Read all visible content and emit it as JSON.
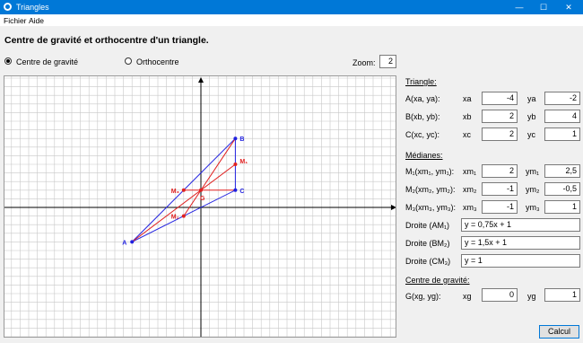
{
  "window": {
    "title": "Triangles",
    "minimize_glyph": "—",
    "maximize_glyph": "☐",
    "close_glyph": "✕"
  },
  "menu": {
    "file": "Fichier",
    "help": "Aide"
  },
  "heading": "Centre de gravité et orthocentre d'un triangle.",
  "options": {
    "gravity": "Centre de gravité",
    "orthocenter": "Orthocentre",
    "selected": "gravity"
  },
  "zoom": {
    "label": "Zoom:",
    "value": "2"
  },
  "plot": {
    "points": {
      "A": "A",
      "B": "B",
      "C": "C",
      "M1": "M₁",
      "M2": "M₂",
      "M3": "M₃",
      "G": "G"
    },
    "colors": {
      "triangle": "#2020e0",
      "median": "#e02020",
      "axis": "#000000",
      "grid": "#c8c8c8"
    }
  },
  "triangle": {
    "title": "Triangle:",
    "rows": [
      {
        "label": "A(xa, ya):",
        "xl": "xa",
        "xv": "-4",
        "yl": "ya",
        "yv": "-2"
      },
      {
        "label": "B(xb, yb):",
        "xl": "xb",
        "xv": "2",
        "yl": "yb",
        "yv": "4"
      },
      {
        "label": "C(xc, yc):",
        "xl": "xc",
        "xv": "2",
        "yl": "yc",
        "yv": "1"
      }
    ]
  },
  "medians": {
    "title": "Médianes:",
    "rows": [
      {
        "label": "M₁(xm₁, ym₁):",
        "xl": "xm₁",
        "xv": "2",
        "yl": "ym₁",
        "yv": "2,5"
      },
      {
        "label": "M₂(xm₂, ym₂):",
        "xl": "xm₂",
        "xv": "-1",
        "yl": "ym₂",
        "yv": "-0,5"
      },
      {
        "label": "M₃(xm₃, ym₃):",
        "xl": "xm₃",
        "xv": "-1",
        "yl": "ym₃",
        "yv": "1"
      }
    ],
    "lines": [
      {
        "label": "Droite (AM₁)",
        "eq": "y = 0,75x + 1"
      },
      {
        "label": "Droite (BM₂)",
        "eq": "y = 1,5x + 1"
      },
      {
        "label": "Droite (CM₃)",
        "eq": "y = 1"
      }
    ]
  },
  "centroid": {
    "title": "Centre de gravité:",
    "label": "G(xg, yg):",
    "xl": "xg",
    "xv": "0",
    "yl": "yg",
    "yv": "1"
  },
  "calc_button": "Calcul"
}
